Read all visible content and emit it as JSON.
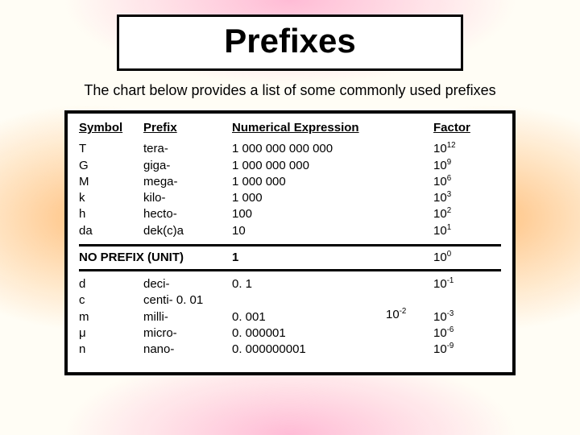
{
  "title": "Prefixes",
  "subtitle": "The chart below provides a list of some commonly used prefixes",
  "headers": {
    "symbol": "Symbol",
    "prefix": "Prefix",
    "numerical": "Numerical Expression",
    "factor": "Factor"
  },
  "upper": [
    {
      "symbol": "T",
      "prefix": "tera-",
      "numerical": "1 000 000 000 000",
      "factor_base": "10",
      "factor_exp": "12"
    },
    {
      "symbol": "G",
      "prefix": "giga-",
      "numerical": "1 000 000 000",
      "factor_base": "10",
      "factor_exp": "9"
    },
    {
      "symbol": "M",
      "prefix": "mega-",
      "numerical": "1 000 000",
      "factor_base": "10",
      "factor_exp": "6"
    },
    {
      "symbol": "k",
      "prefix": "kilo-",
      "numerical": "1 000",
      "factor_base": "10",
      "factor_exp": "3"
    },
    {
      "symbol": "h",
      "prefix": "hecto-",
      "numerical": "100",
      "factor_base": "10",
      "factor_exp": "2"
    },
    {
      "symbol": "da",
      "prefix": "dek(c)a",
      "numerical": "10",
      "factor_base": "10",
      "factor_exp": "1"
    }
  ],
  "unit": {
    "label": "NO PREFIX (UNIT)",
    "numerical": "1",
    "factor_base": "10",
    "factor_exp": "0"
  },
  "lower": [
    {
      "symbol": "d",
      "prefix": "deci-",
      "numerical": "0. 1",
      "factor_base": "10",
      "factor_exp": "-1"
    },
    {
      "symbol": "c",
      "prefix": "centi- 0. 01",
      "numerical": "",
      "factor_base": "",
      "factor_exp": ""
    },
    {
      "symbol": "m",
      "prefix": "milli-",
      "numerical": "0. 001",
      "factor_base": "10",
      "factor_exp": "-3"
    },
    {
      "symbol": "μ",
      "prefix": "micro-",
      "numerical": "0. 000001",
      "factor_base": "10",
      "factor_exp": "-6"
    },
    {
      "symbol": "n",
      "prefix": "nano-",
      "numerical": "0. 000000001",
      "factor_base": "10",
      "factor_exp": "-9"
    }
  ],
  "stray_factor": {
    "base": "10",
    "exp": "-2"
  },
  "chart_data": {
    "type": "table",
    "title": "Prefixes",
    "columns": [
      "Symbol",
      "Prefix",
      "Numerical Expression",
      "Factor"
    ],
    "rows": [
      [
        "T",
        "tera-",
        "1 000 000 000 000",
        "10^12"
      ],
      [
        "G",
        "giga-",
        "1 000 000 000",
        "10^9"
      ],
      [
        "M",
        "mega-",
        "1 000 000",
        "10^6"
      ],
      [
        "k",
        "kilo-",
        "1 000",
        "10^3"
      ],
      [
        "h",
        "hecto-",
        "100",
        "10^2"
      ],
      [
        "da",
        "dek(c)a",
        "10",
        "10^1"
      ],
      [
        "",
        "NO PREFIX (UNIT)",
        "1",
        "10^0"
      ],
      [
        "d",
        "deci-",
        "0.1",
        "10^-1"
      ],
      [
        "c",
        "centi-",
        "0.01",
        "10^-2"
      ],
      [
        "m",
        "milli-",
        "0.001",
        "10^-3"
      ],
      [
        "μ",
        "micro-",
        "0.000001",
        "10^-6"
      ],
      [
        "n",
        "nano-",
        "0.000000001",
        "10^-9"
      ]
    ]
  }
}
